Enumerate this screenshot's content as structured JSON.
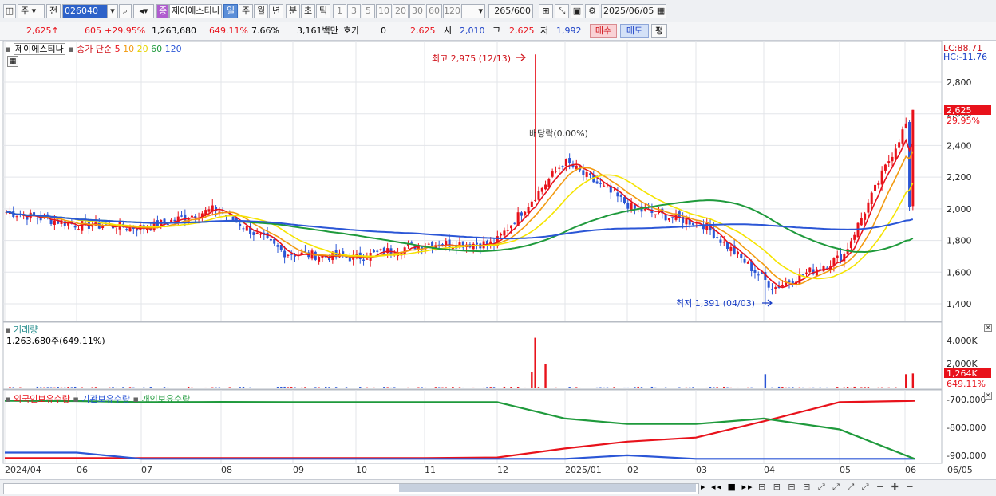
{
  "toolbar": {
    "period_main": "주",
    "exchange": "전",
    "code": "026040",
    "badge": "종",
    "name": "제이에스티나",
    "periods": [
      "일",
      "주",
      "월",
      "년",
      "분",
      "초",
      "틱"
    ],
    "active_period": "일",
    "intervals": [
      "1",
      "3",
      "5",
      "10",
      "20",
      "30",
      "60",
      "120"
    ],
    "count": "265",
    "count_max": "/600",
    "date": "2025/06/05"
  },
  "quote": {
    "price": "2,625",
    "arrow": "↑",
    "change": "605",
    "change_pct": "+29.95%",
    "volume": "1,263,680",
    "volume_ratio": "649.11%",
    "turnover": "7.66%",
    "amount": "3,161백만",
    "hoga_label": "호가",
    "hoga_value": "0",
    "hoga_price": "2,625",
    "open_label": "시",
    "open": "2,010",
    "high_label": "고",
    "high": "2,625",
    "low_label": "저",
    "low": "1,992",
    "buy_label": "매수",
    "sell_label": "매도",
    "eval_label": "평"
  },
  "price_panel": {
    "stock_label": "제이에스티나",
    "ma_label": "종가 단순",
    "ma_periods": [
      "5",
      "10",
      "20",
      "60",
      "120"
    ],
    "ma_colors": [
      "#e8121b",
      "#f29a10",
      "#f5e400",
      "#1f9a3c",
      "#2b56d6"
    ],
    "lc": "LC:88.71",
    "hc": "HC:-11.76",
    "y_ticks": [
      "2,800",
      "2,600",
      "2,400",
      "2,200",
      "2,000",
      "1,800",
      "1,600",
      "1,400"
    ],
    "current_price_tag": "2,625",
    "current_change_tag": "29.95%",
    "high_marker": "최고 2,975 (12/13)",
    "low_marker": "최저 1,391 (04/03)",
    "dividend_label": "배당락(0.00%)"
  },
  "volume_panel": {
    "title": "거래량",
    "value": "1,263,680주(649.11%)",
    "y_ticks": [
      "4,000K",
      "2,000K"
    ],
    "current_tag": "1,264K",
    "current_pct": "649.11%"
  },
  "holding_panel": {
    "series": [
      {
        "name": "외국인보유수량",
        "color": "#e8121b"
      },
      {
        "name": "기관보유수량",
        "color": "#2b56d6"
      },
      {
        "name": "개인보유수량",
        "color": "#1f9a3c"
      }
    ],
    "y_ticks": [
      "-700,000",
      "-800,000",
      "-900,000"
    ]
  },
  "x_axis": [
    "2024/04",
    "06",
    "07",
    "08",
    "09",
    "10",
    "11",
    "12",
    "2025/01",
    "02",
    "03",
    "04",
    "05",
    "06",
    "06/05"
  ],
  "chart_data": [
    {
      "type": "candlestick",
      "title": "제이에스티나",
      "ylim": [
        1300,
        3000
      ],
      "x": [
        "2024/04",
        "06",
        "07",
        "08",
        "09",
        "10",
        "11",
        "12",
        "2025/01",
        "02",
        "03",
        "04",
        "05",
        "06"
      ],
      "close_approx": [
        1980,
        1900,
        1880,
        2000,
        1720,
        1690,
        1780,
        1780,
        2300,
        2000,
        1900,
        1500,
        1700,
        2625
      ],
      "high": 2975,
      "high_date": "12/13",
      "low": 1391,
      "low_date": "04/03"
    },
    {
      "type": "bar",
      "title": "거래량",
      "ylim": [
        0,
        5000
      ],
      "unit": "K",
      "last_value": 1264
    },
    {
      "type": "line",
      "ylim": [
        -920000,
        -690000
      ],
      "series": [
        {
          "name": "외국인보유수량",
          "values": [
            -915000,
            -915000,
            -915000,
            -915000,
            -915000,
            -915000,
            -915000,
            -913000,
            -880000,
            -855000,
            -840000,
            -780000,
            -710000,
            -705000
          ]
        },
        {
          "name": "기관보유수량",
          "values": [
            -895000,
            -895000,
            -918000,
            -918000,
            -918000,
            -918000,
            -918000,
            -918000,
            -918000,
            -905000,
            -918000,
            -918000,
            -918000,
            -918000
          ]
        },
        {
          "name": "개인보유수량",
          "values": [
            -705000,
            -706000,
            -710000,
            -709000,
            -710000,
            -710000,
            -710000,
            -710000,
            -770000,
            -790000,
            -790000,
            -770000,
            -810000,
            -918000
          ]
        }
      ]
    }
  ]
}
